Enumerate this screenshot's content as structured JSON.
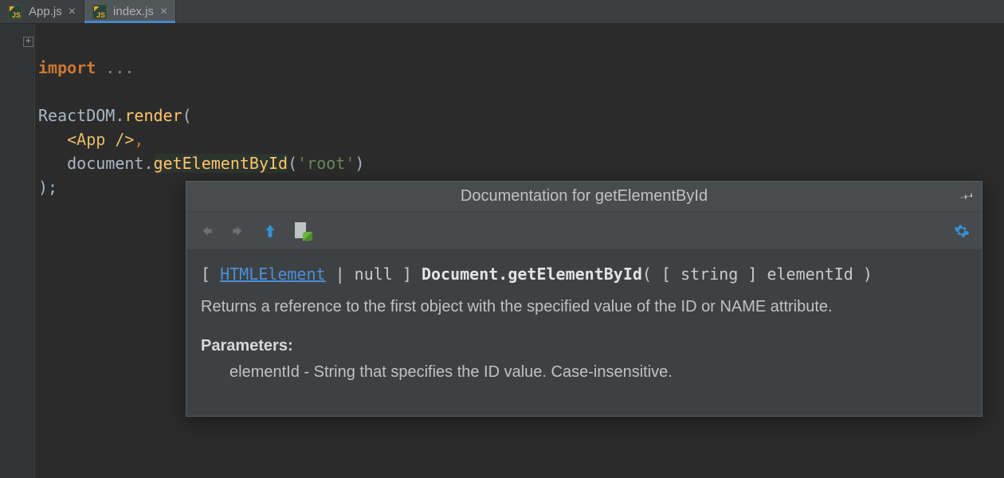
{
  "tabs": [
    {
      "label": "App.js",
      "active": false
    },
    {
      "label": "index.js",
      "active": true
    }
  ],
  "code": {
    "import_kw": "import",
    "fold_dots": " ...",
    "line3_a": "ReactDOM",
    "line3_b": ".",
    "line3_c": "render",
    "line3_d": "(",
    "line4_indent": "   ",
    "line4_jsx": "<App />",
    "line4_comma": ",",
    "line5_indent": "   ",
    "line5_a": "document",
    "line5_b": ".",
    "line5_c": "getElementById",
    "line5_d": "(",
    "line5_e": "'root'",
    "line5_f": ")",
    "line6": ");"
  },
  "doc": {
    "title": "Documentation for getElementById",
    "sig_open": "[ ",
    "sig_link": "HTMLElement",
    "sig_mid1": " | null ] ",
    "sig_strong": "Document.getElementById",
    "sig_tail": "( [ string ] elementId )",
    "description": "Returns a reference to the first object with the specified value of the ID or NAME attribute.",
    "params_heading": "Parameters:",
    "param1": "elementId - String that specifies the ID value. Case-insensitive."
  }
}
